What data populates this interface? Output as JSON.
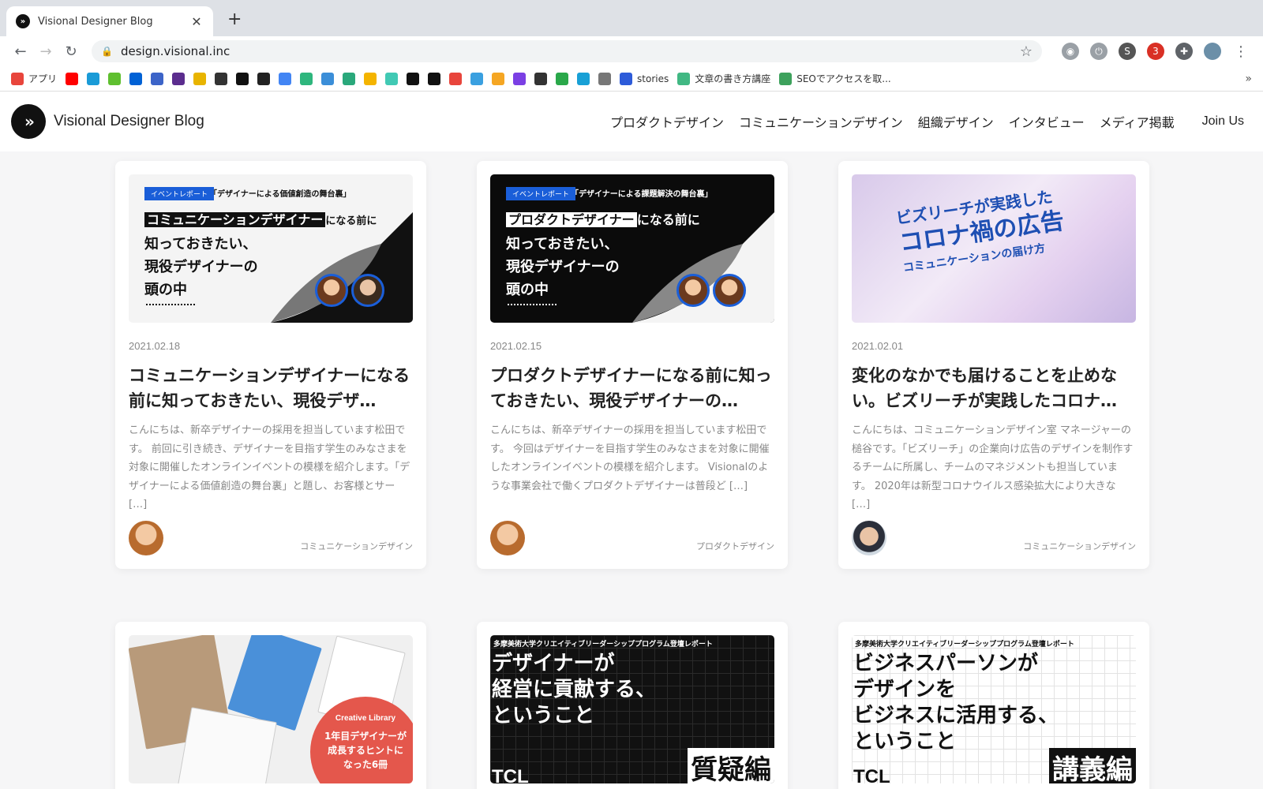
{
  "browser": {
    "tab_title": "Visional Designer Blog",
    "url": "design.visional.inc",
    "bookmarks": [
      {
        "icon": "apps-grid-icon",
        "label": "アプリ",
        "color": "#e8453c"
      },
      {
        "icon": "youtube-icon",
        "label": "",
        "color": "#ff0000"
      },
      {
        "icon": "contacts-icon",
        "label": "",
        "color": "#1a9bd7"
      },
      {
        "icon": "leaf-icon",
        "label": "",
        "color": "#5fbf2f"
      },
      {
        "icon": "box-icon",
        "label": "",
        "color": "#0061d5"
      },
      {
        "icon": "table-icon",
        "label": "",
        "color": "#3c64c8"
      },
      {
        "icon": "p-icon",
        "label": "",
        "color": "#5b2d8e"
      },
      {
        "icon": "c-icon",
        "label": "",
        "color": "#e8b400"
      },
      {
        "icon": "cube-icon",
        "label": "",
        "color": "#333333"
      },
      {
        "icon": "blocks-icon",
        "label": "",
        "color": "#111111"
      },
      {
        "icon": "amazon-icon",
        "label": "",
        "color": "#222222"
      },
      {
        "icon": "google-icon",
        "label": "",
        "color": "#4285f4"
      },
      {
        "icon": "slack-icon",
        "label": "",
        "color": "#2eb67d"
      },
      {
        "icon": "swirl-icon",
        "label": "",
        "color": "#3b8ed8"
      },
      {
        "icon": "bird-icon",
        "label": "",
        "color": "#2aa87b"
      },
      {
        "icon": "drive-icon",
        "label": "",
        "color": "#f4b400"
      },
      {
        "icon": "note-icon",
        "label": "",
        "color": "#41c9b4"
      },
      {
        "icon": "s-icon",
        "label": "",
        "color": "#111111"
      },
      {
        "icon": "jdn-icon",
        "label": "",
        "color": "#111111"
      },
      {
        "icon": "calendar-icon",
        "label": "",
        "color": "#e8453c"
      },
      {
        "icon": "arc-icon",
        "label": "",
        "color": "#3aa0e0"
      },
      {
        "icon": "package-icon",
        "label": "",
        "color": "#f5a623"
      },
      {
        "icon": "circle-icon",
        "label": "",
        "color": "#7b3fe4"
      },
      {
        "icon": "panda-icon",
        "label": "",
        "color": "#333333"
      },
      {
        "icon": "chevron-icon",
        "label": "",
        "color": "#2aa84a"
      },
      {
        "icon": "flag-icon",
        "label": "",
        "color": "#18a0d6"
      },
      {
        "icon": "power-icon",
        "label": "",
        "color": "#777777"
      },
      {
        "icon": "stories-icon",
        "label": "stories",
        "color": "#2d5bd9"
      },
      {
        "icon": "doc-icon",
        "label": "文章の書き方講座",
        "color": "#41b883"
      },
      {
        "icon": "seo-icon",
        "label": "SEOでアクセスを取...",
        "color": "#3da15c"
      }
    ],
    "bookmarks_more": "»"
  },
  "site": {
    "title": "Visional Designer Blog",
    "nav": [
      "プロダクトデザイン",
      "コミュニケーションデザイン",
      "組織デザイン",
      "インタビュー",
      "メディア掲載"
    ],
    "join": "Join Us"
  },
  "posts": [
    {
      "date": "2021.02.18",
      "title": "コミュニケーションデザイナーになる前に知っておきたい、現役デザ…",
      "excerpt": "こんにちは、新卒デザイナーの採用を担当しています松田です。 前回に引き続き、デザイナーを目指す学生のみなさまを対象に開催したオンラインイベントの模様を紹介します。「デザイナーによる価値創造の舞台裏」と題し、お客様とサー […]",
      "category": "コミュニケーションデザイン",
      "thumb": {
        "tag": "イベントレポート",
        "tagline": "「デザイナーによる価値創造の舞台裏」",
        "box": "コミュニケーションデザイナー",
        "after": "になる前に",
        "lines": "知っておきたい、\n現役デザイナーの\n頭の中"
      }
    },
    {
      "date": "2021.02.15",
      "title": "プロダクトデザイナーになる前に知っておきたい、現役デザイナーの…",
      "excerpt": "こんにちは、新卒デザイナーの採用を担当しています松田です。 今回はデザイナーを目指す学生のみなさまを対象に開催したオンラインイベントの模様を紹介します。 Visionalのような事業会社で働くプロダクトデザイナーは普段ど […]",
      "category": "プロダクトデザイン",
      "thumb": {
        "tag": "イベントレポート",
        "tagline": "「デザイナーによる課題解決の舞台裏」",
        "box": "プロダクトデザイナー",
        "after": "になる前に",
        "lines": "知っておきたい、\n現役デザイナーの\n頭の中"
      }
    },
    {
      "date": "2021.02.01",
      "title": "変化のなかでも届けることを止めない。ビズリーチが実践したコロナ…",
      "excerpt": "こんにちは、コミュニケーションデザイン室 マネージャーの槌谷です。「ビズリーチ」の企業向け広告のデザインを制作するチームに所属し、チームのマネジメントも担当しています。 2020年は新型コロナウイルス感染拡大により大きな […]",
      "category": "コミュニケーションデザイン",
      "thumb": {
        "l1": "ビズリーチが実践した",
        "l2": "コロナ禍の広告",
        "l3": "コミュニケーションの届け方"
      }
    }
  ],
  "posts_row2": [
    {
      "badge_label": "Creative Library",
      "badge_text": "1年目デザイナーが\n成長するヒントに\nなった6冊"
    },
    {
      "cap": "多摩美術大学クリエイティブリーダーシッププログラム登壇レポート",
      "main": "デザイナーが\n経営に貢献する、\nということ",
      "logo": "TCL",
      "badge": "質疑編"
    },
    {
      "cap": "多摩美術大学クリエイティブリーダーシッププログラム登壇レポート",
      "main": "ビジネスパーソンが\nデザインを\nビジネスに活用する、\nということ",
      "logo": "TCL",
      "badge": "講義編"
    }
  ]
}
